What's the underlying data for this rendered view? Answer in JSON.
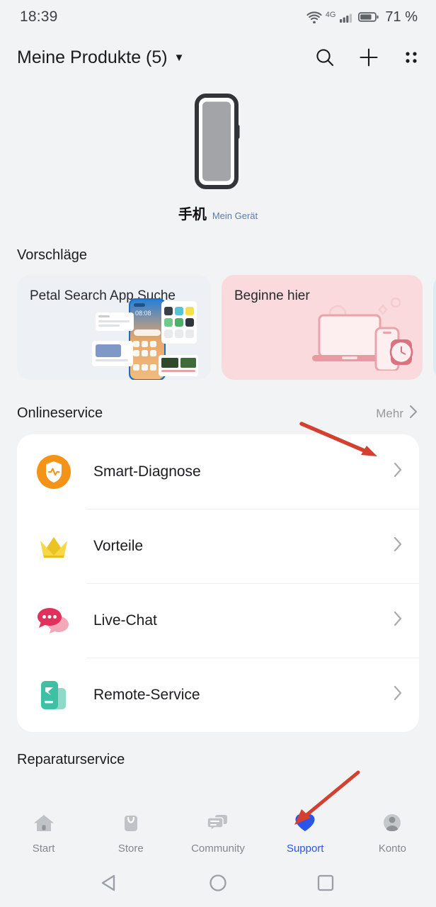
{
  "status_bar": {
    "time": "18:39",
    "wifi_icon": "wifi-icon",
    "network_label": "4G",
    "signal_icon": "cellular-signal-icon",
    "battery_icon": "battery-icon",
    "battery_percent": "71 %"
  },
  "app_bar": {
    "title": "Meine Produkte (5)",
    "caret_icon": "chevron-down-icon",
    "search_icon": "search-icon",
    "add_icon": "plus-icon",
    "grid_icon": "grid-menu-icon"
  },
  "device": {
    "illustration": "phone-device-illustration",
    "name": "手机",
    "subtitle": "Mein Gerät"
  },
  "suggestions": {
    "title": "Vorschläge",
    "cards": [
      {
        "label": "Petal Search App Suche",
        "illustration": "petal-search-phone-illustration",
        "bg": "#edf1f6"
      },
      {
        "label": "Beginne hier",
        "illustration": "devices-laptop-phone-watch-illustration",
        "bg": "#fadadd"
      },
      {
        "label": "",
        "illustration": "partial-card-illustration",
        "bg": "#d8eef2"
      }
    ]
  },
  "online_service": {
    "title": "Onlineservice",
    "more_label": "Mehr",
    "more_chevron_icon": "chevron-right-icon",
    "items": [
      {
        "label": "Smart-Diagnose",
        "icon": "shield-pulse-icon",
        "color": "#f39318",
        "chevron": "chevron-right-icon"
      },
      {
        "label": "Vorteile",
        "icon": "crown-icon",
        "color": "#f5cf2b",
        "chevron": "chevron-right-icon"
      },
      {
        "label": "Live-Chat",
        "icon": "chat-bubble-icon",
        "color": "#e0315c",
        "chevron": "chevron-right-icon"
      },
      {
        "label": "Remote-Service",
        "icon": "remote-service-icon",
        "color": "#3fbfa3",
        "chevron": "chevron-right-icon"
      }
    ]
  },
  "next_section": {
    "title": "Reparaturservice"
  },
  "tab_bar": {
    "active_color": "#2a55e8",
    "inactive_color": "#85888c",
    "tabs": [
      {
        "label": "Start",
        "icon": "home-icon",
        "active": false
      },
      {
        "label": "Store",
        "icon": "shopping-bag-icon",
        "active": false
      },
      {
        "label": "Community",
        "icon": "community-chat-icon",
        "active": false
      },
      {
        "label": "Support",
        "icon": "heart-icon",
        "active": true
      },
      {
        "label": "Konto",
        "icon": "account-avatar-icon",
        "active": false
      }
    ]
  },
  "system_nav": {
    "back_icon": "back-triangle-icon",
    "home_icon": "home-circle-icon",
    "recents_icon": "recents-square-icon"
  },
  "annotations": {
    "color": "#d3402f",
    "arrows": [
      {
        "name": "arrow-pointing-to-mehr",
        "target": "Mehr"
      },
      {
        "name": "arrow-pointing-to-support-tab",
        "target": "Support"
      }
    ]
  }
}
